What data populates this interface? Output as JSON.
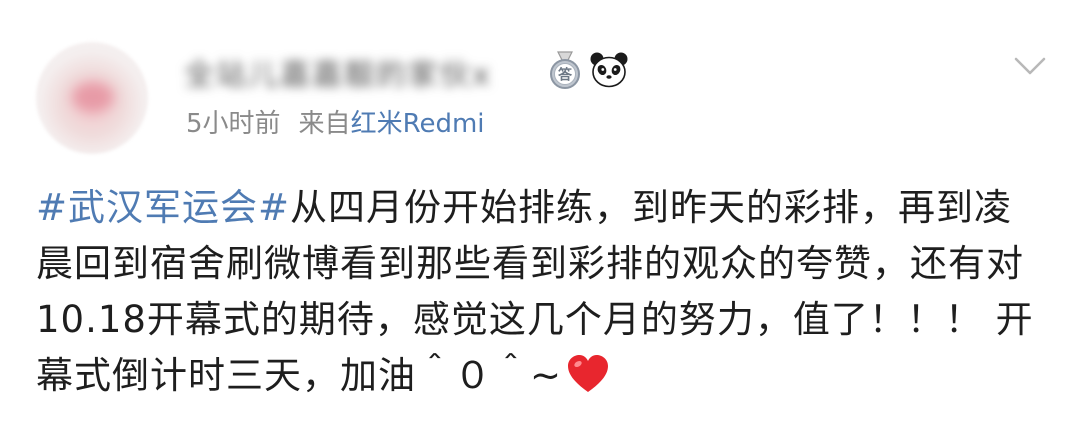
{
  "post": {
    "username": "全站儿嘉嘉靓的家伙x",
    "time": "5小时前",
    "source_prefix": "来自",
    "source_device": "红米Redmi",
    "hashtag": "#武汉军运会#",
    "body": "从四月份开始排练，到昨天的彩排，再到凌晨回到宿舍刷微博看到那些看到彩排的观众的夸赞，还有对10.18开幕式的期待，感觉这几个月的努力，值了！！！ 开幕式倒计时三天，加油＾０＾~",
    "answer_badge_char": "答"
  },
  "icons": {
    "avatar": "avatar",
    "badge_1": "answer-medal-icon",
    "badge_2": "panda-icon",
    "menu": "chevron-down-icon",
    "emoji": "red-heart-icon"
  },
  "colors": {
    "link": "#4f7bb3",
    "meta": "#8a8a8a",
    "text": "#1e1e1e",
    "heart": "#e8262e"
  }
}
